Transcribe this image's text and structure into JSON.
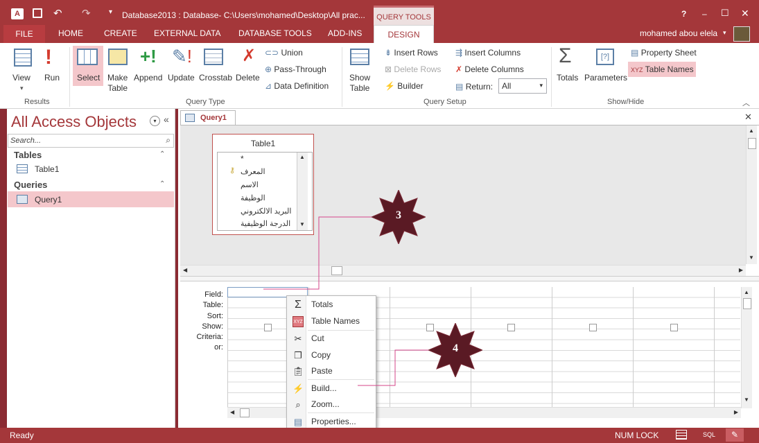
{
  "titlebar": {
    "app_icon": "access-logo-icon",
    "title": "Database2013 : Database- C:\\Users\\mohamed\\Desktop\\All prac...",
    "context_tab": "QUERY TOOLS",
    "help": "?",
    "minimize": "–",
    "restore": "☐",
    "close": "✕"
  },
  "tabs": [
    "FILE",
    "HOME",
    "CREATE",
    "EXTERNAL DATA",
    "DATABASE TOOLS",
    "ADD-INS",
    "DESIGN"
  ],
  "user": "mohamed abou elela",
  "ribbon": {
    "results": {
      "group": "Results",
      "view": "View",
      "run": "Run"
    },
    "query_type": {
      "group": "Query Type",
      "select": "Select",
      "make_table_1": "Make",
      "make_table_2": "Table",
      "append": "Append",
      "update": "Update",
      "crosstab": "Crosstab",
      "delete": "Delete",
      "union": "Union",
      "pass_through": "Pass-Through",
      "data_definition": "Data Definition"
    },
    "query_setup": {
      "group": "Query Setup",
      "show_table_1": "Show",
      "show_table_2": "Table",
      "insert_rows": "Insert Rows",
      "delete_rows": "Delete Rows",
      "builder": "Builder",
      "insert_columns": "Insert Columns",
      "delete_columns": "Delete Columns",
      "return_label": "Return:",
      "return_value": "All"
    },
    "show_hide": {
      "group": "Show/Hide",
      "totals": "Totals",
      "parameters": "Parameters",
      "property_sheet": "Property Sheet",
      "table_names": "Table Names"
    }
  },
  "nav": {
    "title": "All Access Objects",
    "search_placeholder": "Search...",
    "tables_header": "Tables",
    "tables": [
      "Table1"
    ],
    "queries_header": "Queries",
    "queries": [
      "Query1"
    ]
  },
  "document_tab": "Query1",
  "table_box": {
    "title": "Table1",
    "fields": [
      "*",
      "المعرف",
      "الاسم",
      "الوظيفة",
      "البريد الالكتروني",
      "الدرجة الوظيفية"
    ]
  },
  "grid_rows": [
    "Field:",
    "Table:",
    "Sort:",
    "Show:",
    "Criteria:",
    "or:"
  ],
  "context_menu": [
    {
      "label": "Totals",
      "icon": "sigma-icon",
      "enabled": true
    },
    {
      "label": "Table Names",
      "icon": "table-names-icon",
      "enabled": true
    },
    {
      "label": "Cut",
      "icon": "scissors-icon",
      "enabled": false
    },
    {
      "label": "Copy",
      "icon": "copy-icon",
      "enabled": false
    },
    {
      "label": "Paste",
      "icon": "paste-icon",
      "enabled": false
    },
    {
      "label": "Build...",
      "icon": "wand-icon",
      "enabled": true
    },
    {
      "label": "Zoom...",
      "icon": "magnifier-icon",
      "enabled": true
    },
    {
      "label": "Properties...",
      "icon": "properties-icon",
      "enabled": true
    }
  ],
  "callouts": [
    "3",
    "4"
  ],
  "status": {
    "left": "Ready",
    "numlock": "NUM LOCK",
    "sql": "SQL"
  },
  "colors": {
    "accent": "#a4373a",
    "callout": "#5a1a24",
    "callout_line": "#d4458a",
    "highlight": "#f4c7cb"
  }
}
